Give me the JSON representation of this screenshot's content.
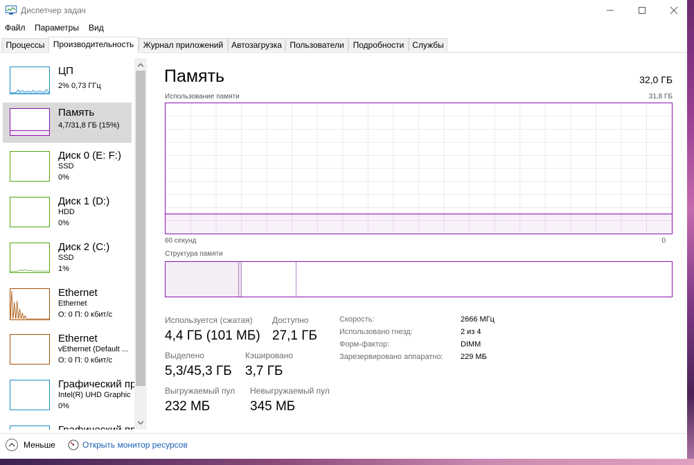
{
  "window": {
    "title": "Диспетчер задач",
    "controls": {
      "minimize": "—",
      "maximize": "☐",
      "close": "✕"
    }
  },
  "menu": [
    "Файл",
    "Параметры",
    "Вид"
  ],
  "tabs": [
    {
      "label": "Процессы",
      "active": false
    },
    {
      "label": "Производительность",
      "active": true
    },
    {
      "label": "Журнал приложений",
      "active": false
    },
    {
      "label": "Автозагрузка",
      "active": false
    },
    {
      "label": "Пользователи",
      "active": false
    },
    {
      "label": "Подробности",
      "active": false
    },
    {
      "label": "Службы",
      "active": false
    }
  ],
  "sidebar": {
    "items": [
      {
        "name": "ЦП",
        "line1": "2% 0,73 ГГц",
        "line2": "",
        "color": "#1b8cc9"
      },
      {
        "name": "Память",
        "line1": "4,7/31,8 ГБ (15%)",
        "line2": "",
        "color": "#8b12ae"
      },
      {
        "name": "Диск 0 (E: F:)",
        "line1": "SSD",
        "line2": "0%",
        "color": "#4da60c"
      },
      {
        "name": "Диск 1 (D:)",
        "line1": "HDD",
        "line2": "0%",
        "color": "#4da60c"
      },
      {
        "name": "Диск 2 (C:)",
        "line1": "SSD",
        "line2": "1%",
        "color": "#4da60c"
      },
      {
        "name": "Ethernet",
        "line1": "Ethernet",
        "line2": "О: 0 П: 0 кбит/с",
        "color": "#a74f01"
      },
      {
        "name": "Ethernet",
        "line1": "vEthernet (Default ...",
        "line2": "О: 0 П: 0 кбит/с",
        "color": "#a74f01"
      },
      {
        "name": "Графический пр",
        "line1": "Intel(R) UHD Graphic",
        "line2": "0%",
        "color": "#1b8cc9"
      },
      {
        "name": "Графический пр",
        "line1": "",
        "line2": "",
        "color": "#1b8cc9"
      }
    ]
  },
  "main": {
    "title": "Память",
    "total": "32,0 ГБ",
    "usage_label": "Использование памяти",
    "usage_max": "31,8 ГБ",
    "usage_fraction": 0.15,
    "time_left": "60 секунд",
    "time_right": "0",
    "composition_label": "Структура памяти",
    "stats": {
      "in_use_label": "Используется (сжатая)",
      "in_use_value": "4,4 ГБ (101 МБ)",
      "available_label": "Доступно",
      "available_value": "27,1 ГБ",
      "committed_label": "Выделено",
      "committed_value": "5,3/45,3 ГБ",
      "cached_label": "Кэшировано",
      "cached_value": "3,7 ГБ",
      "paged_label": "Выгружаемый пул",
      "paged_value": "232 МБ",
      "nonpaged_label": "Невыгружаемый пул",
      "nonpaged_value": "345 МБ"
    },
    "info": [
      {
        "label": "Скорость:",
        "value": "2666 МГц"
      },
      {
        "label": "Использовано гнезд:",
        "value": "2 из 4"
      },
      {
        "label": "Форм-фактор:",
        "value": "DIMM"
      },
      {
        "label": "Зарезервировано аппаратно:",
        "value": "229 МБ"
      }
    ]
  },
  "footer": {
    "less_label": "Меньше",
    "resource_monitor_label": "Открыть монитор ресурсов"
  },
  "colors": {
    "memory": "#8b12ae",
    "link": "#1a5fb4"
  }
}
